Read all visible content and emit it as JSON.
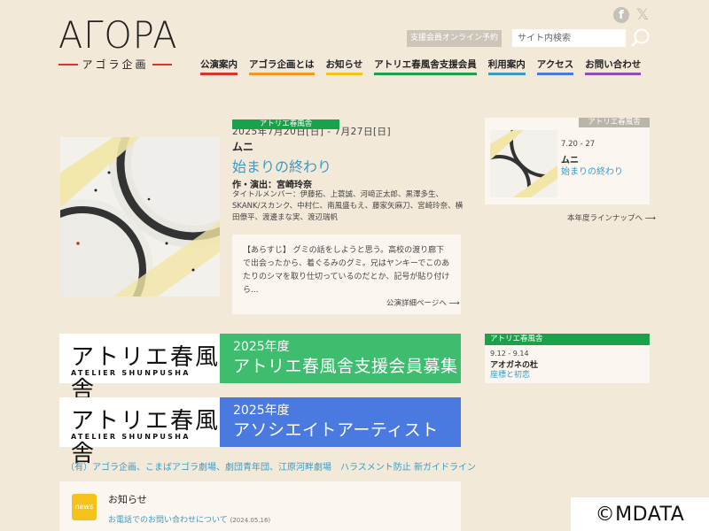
{
  "logo": {
    "main": "AΓOPA",
    "sub": "アゴラ企画"
  },
  "header": {
    "online_booking": "支援会員オンライン予約",
    "search_placeholder": "サイト内検索"
  },
  "nav": [
    {
      "label": "公演案内",
      "color": "#d9362b"
    },
    {
      "label": "アゴラ企画とは",
      "color": "#f39a1e"
    },
    {
      "label": "お知らせ",
      "color": "#f4c21a"
    },
    {
      "label": "アトリエ春風舎支援会員",
      "color": "#1aa24a"
    },
    {
      "label": "利用案内",
      "color": "#3a9bc4"
    },
    {
      "label": "アクセス",
      "color": "#4a79e0"
    },
    {
      "label": "お問い合わせ",
      "color": "#8e4fb5"
    }
  ],
  "featured": {
    "tag": "アトリエ春風舎",
    "date": "2025年7月20日[日] - 7月27日[日]",
    "title": "ムニ",
    "subtitle": "始まりの終わり",
    "author": "作・演出：宮崎玲奈",
    "members": "タイトルメンバー：伊藤拓、上蓑誠、河﨑正太郎、黒澤多生、SKANK/スカンク、中村仁、南風盛もえ、藤家矢麻刀、宮崎玲奈、横田僚平、渡邊まな実、渡辺瑞帆",
    "synopsis": "【あらすじ】 グミの話をしようと思う。高校の渡り廊下で出会ったから、着ぐるみのグミ。兄はヤンキーでこのあたりのシマを取り仕切っているのだとか、記号が貼り付けら...",
    "detail_link": "公演詳細ページへ"
  },
  "side_event": {
    "tag": "アトリエ春風舎",
    "date": "7.20 - 27",
    "title": "ムニ",
    "subtitle": "始まりの終わり",
    "lineup_link": "本年度ラインナップへ"
  },
  "banners": [
    {
      "kanji": "アトリエ春風舎",
      "roman": "ATELIER SHUNPUSHA",
      "year": "2025年度",
      "text": "アトリエ春風舎支援会員募集"
    },
    {
      "kanji": "アトリエ春風舎",
      "roman": "ATELIER SHUNPUSHA",
      "year": "2025年度",
      "text": "アソシエイトアーティスト"
    }
  ],
  "ticker": "（有）アゴラ企画、こまばアゴラ劇場、劇団青年団、江原河畔劇場　ハラスメント防止 新ガイドライン",
  "side_event2": {
    "tag": "アトリエ春風舎",
    "date": "9.12 - 9.14",
    "title": "アオガネの杜",
    "subtitle": "座標と初恋"
  },
  "news": {
    "icon_label": "news",
    "heading": "お知らせ",
    "items": [
      {
        "title": "お電話でのお問い合わせについて",
        "date": "(2024.05.16)"
      }
    ]
  },
  "watermark": "©MDATA"
}
